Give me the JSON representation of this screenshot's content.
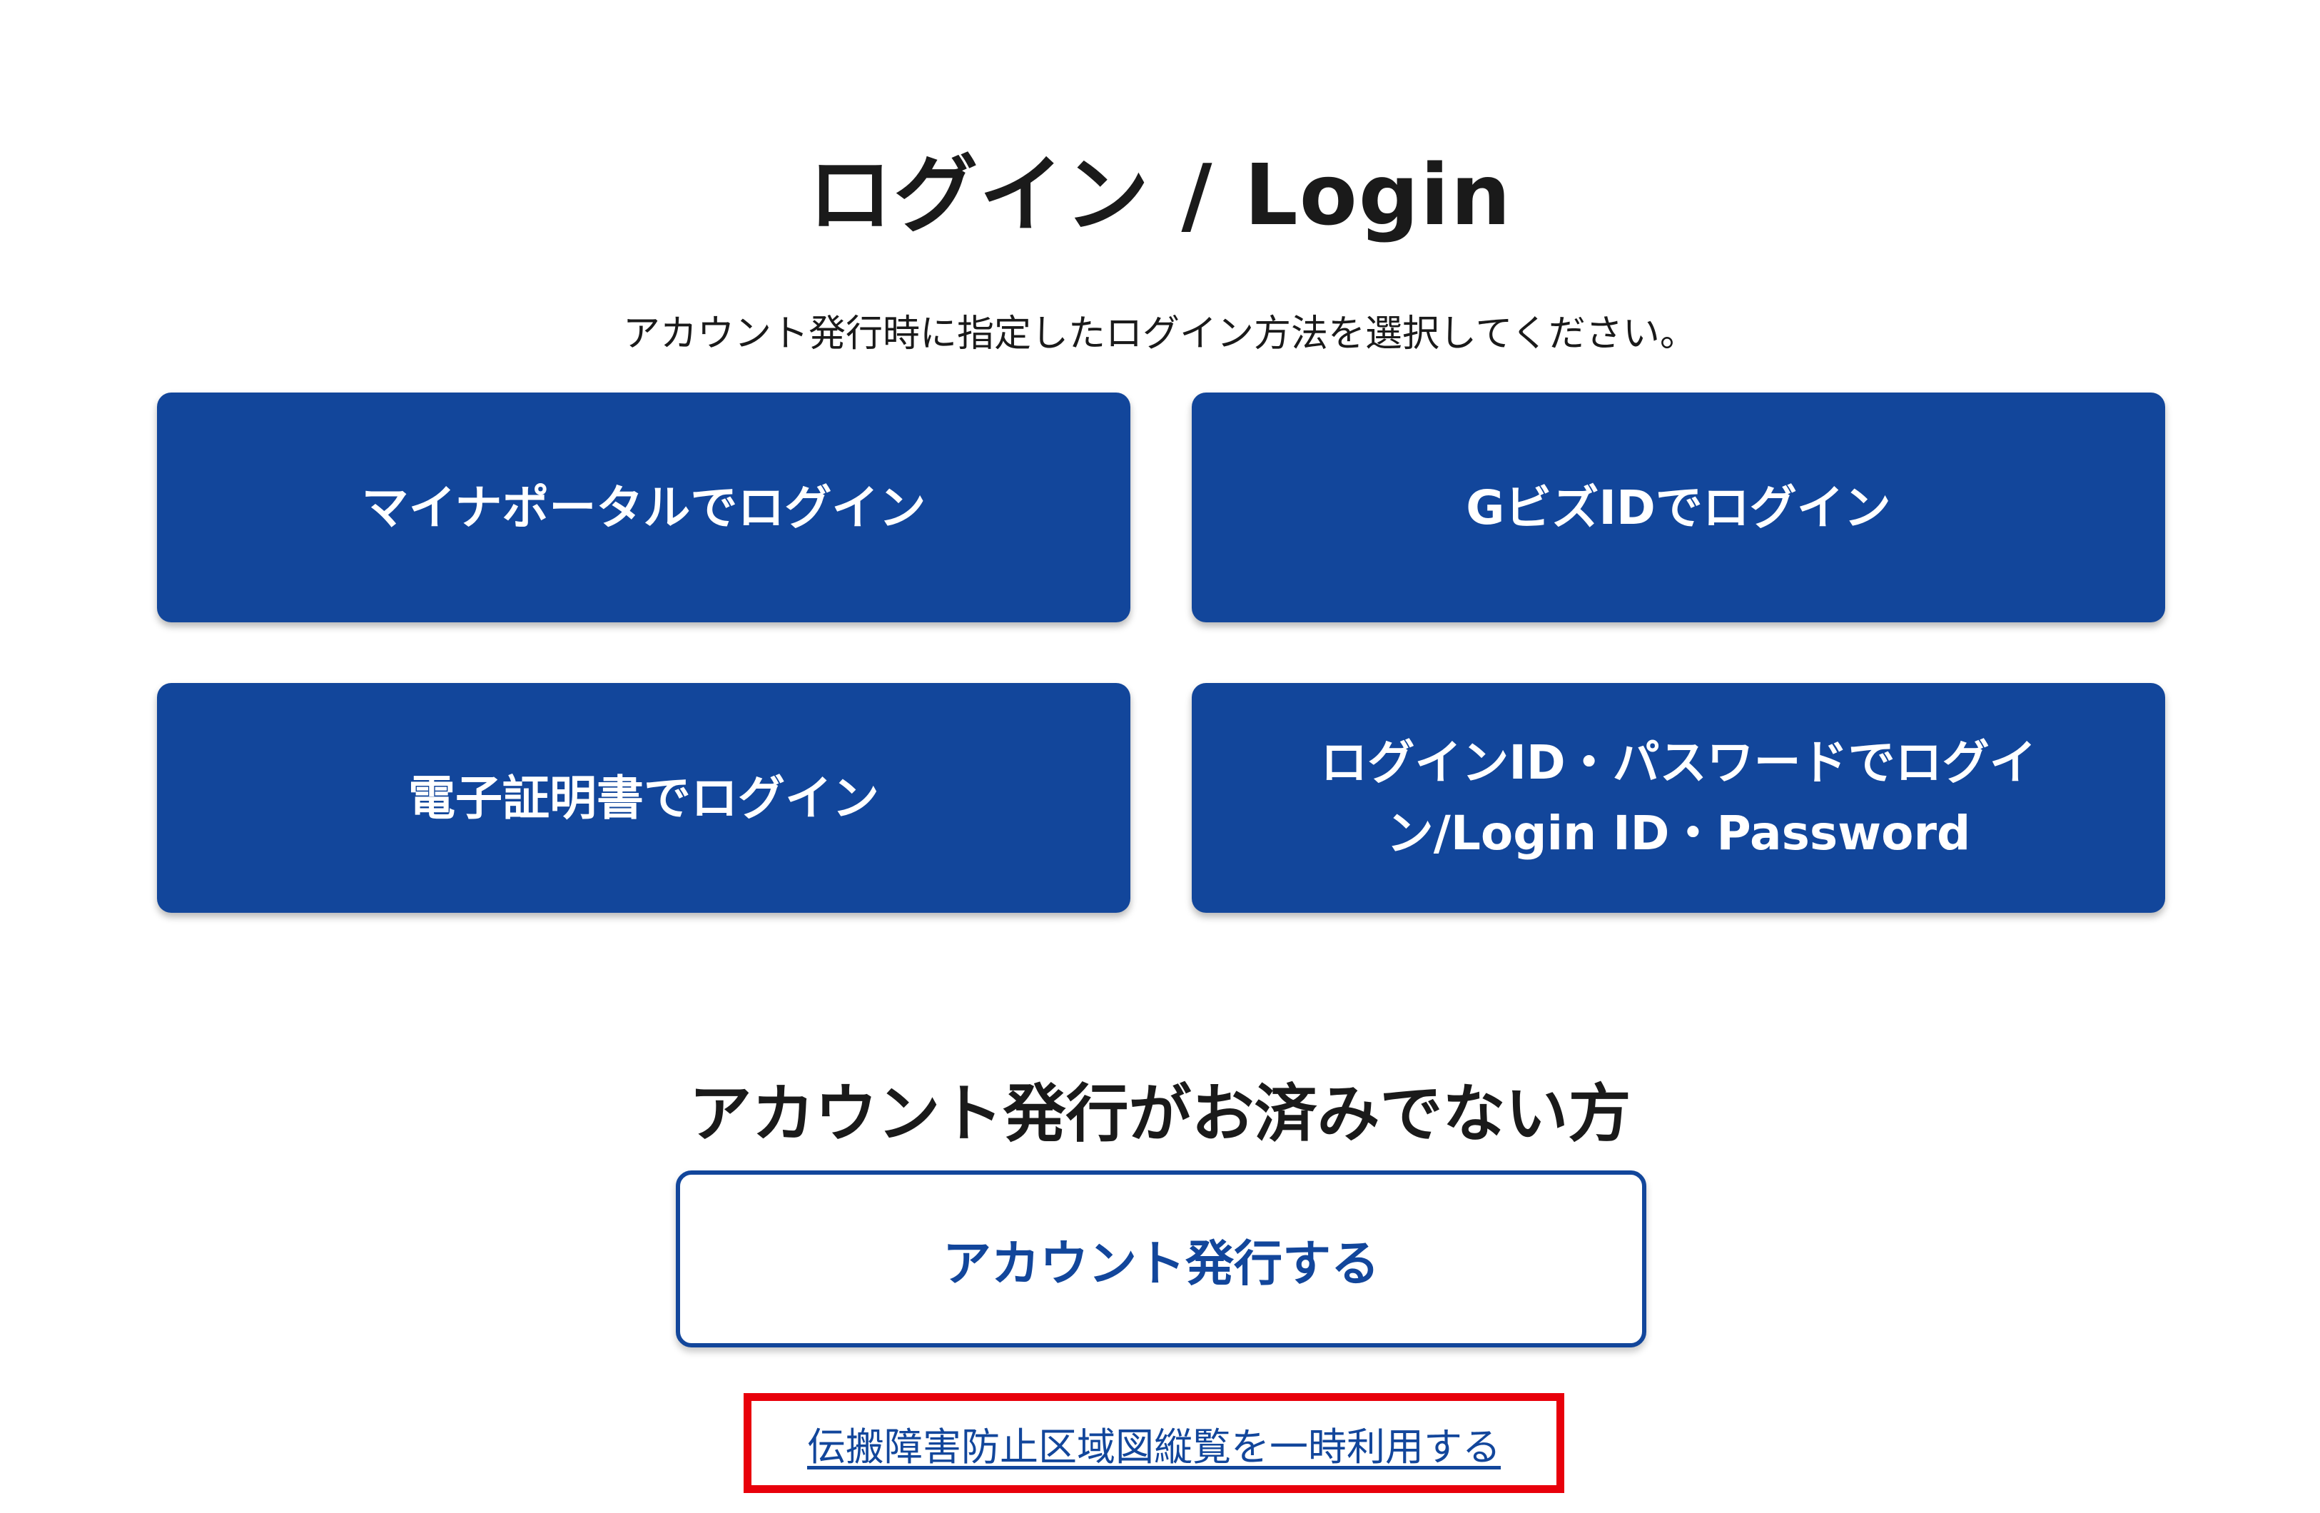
{
  "page": {
    "title": "ログイン / Login",
    "subtitle": "アカウント発行時に指定したログイン方法を選択してください。"
  },
  "login_options": {
    "mynaportal": "マイナポータルでログイン",
    "gbiz": "GビズIDでログイン",
    "certificate": "電子証明書でログイン",
    "loginid": "ログインID・パスワードでログイン/Login ID・Password"
  },
  "no_account": {
    "heading": "アカウント発行がお済みでない方",
    "button_label": "アカウント発行する"
  },
  "temporary_use": {
    "link_label": "伝搬障害防止区域図縦覧を一時利用する",
    "highlight_color": "#e8000b"
  },
  "colors": {
    "primary": "#12469b",
    "text": "#1a1a1a",
    "background": "#ffffff"
  }
}
